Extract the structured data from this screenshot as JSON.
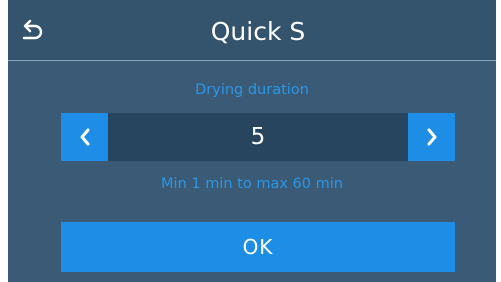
{
  "header": {
    "title": "Quick S",
    "back_icon": "undo-back-arrow-icon"
  },
  "setting": {
    "label": "Drying duration",
    "value": "5",
    "range_hint": "Min 1 min to max 60 min",
    "decrement_icon": "chevron-left-icon",
    "increment_icon": "chevron-right-icon"
  },
  "actions": {
    "ok_label": "OK"
  },
  "colors": {
    "background": "#3a5a75",
    "header": "#34546e",
    "accent": "#1d8de5",
    "label_text": "#2a97e8",
    "value_field": "#27455e"
  }
}
